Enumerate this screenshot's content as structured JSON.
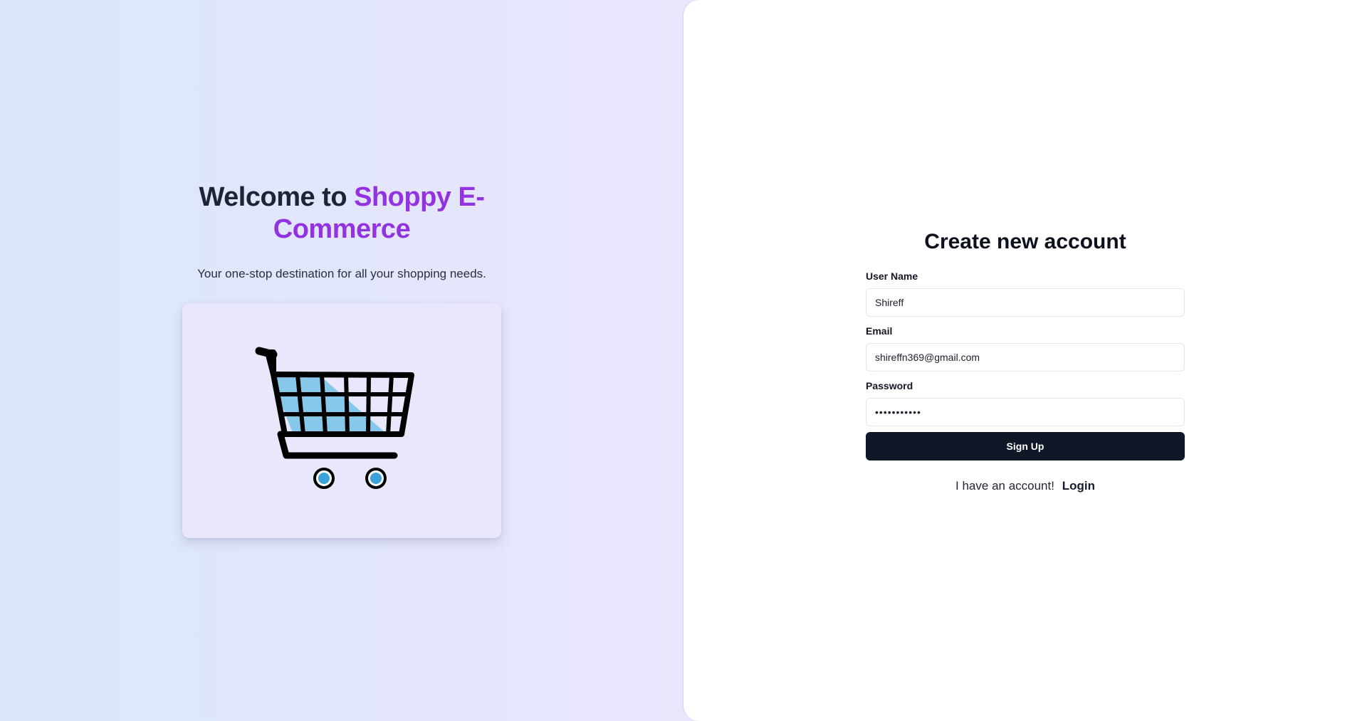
{
  "hero": {
    "title_prefix": "Welcome to",
    "title_brand": "Shoppy E-Commerce",
    "subtitle": "Your one-stop destination for all your shopping needs."
  },
  "cart_image": {
    "icon": "shopping-cart-icon"
  },
  "signup_form": {
    "title": "Create new account",
    "username_label": "User Name",
    "username_value": "Shireff",
    "email_label": "Email",
    "email_value": "shireffn369@gmail.com",
    "password_label": "Password",
    "password_value": "shireff1234",
    "submit_label": "Sign Up",
    "login_prompt": "I have an account!",
    "login_link": "Login"
  },
  "colors": {
    "brand": "#9332e0",
    "button": "#101828",
    "cart_fill": "#86c7ea",
    "wheel": "#3ba2dc"
  }
}
